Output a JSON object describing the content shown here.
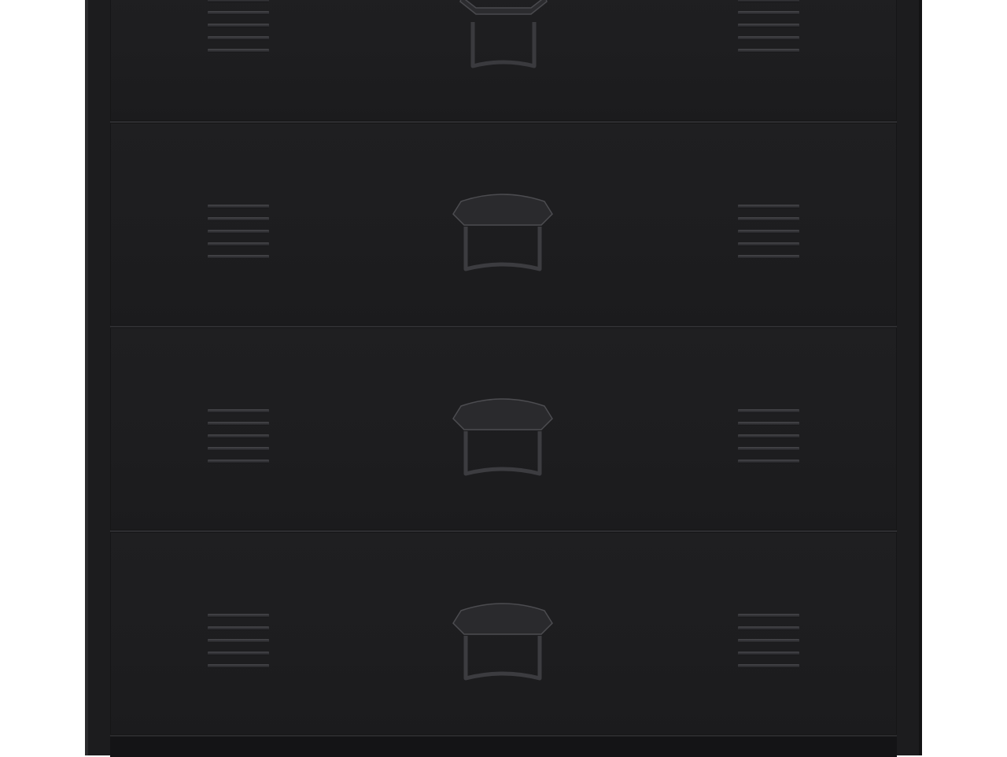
{
  "product": {
    "name": "steel-chest-of-drawers",
    "color": "#1d1d1f",
    "background": "#ffffff",
    "visible_drawers": 4,
    "vent_slats_per_side": 5
  },
  "drawers": [
    {
      "id": "drawer-1",
      "partial": true
    },
    {
      "id": "drawer-2",
      "partial": false
    },
    {
      "id": "drawer-3",
      "partial": false
    },
    {
      "id": "drawer-4",
      "partial": false
    }
  ]
}
